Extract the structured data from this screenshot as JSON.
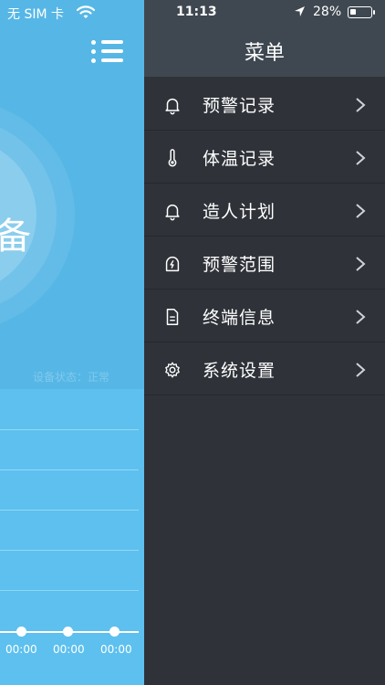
{
  "status_bar": {
    "carrier": "无 SIM 卡",
    "time": "11:13",
    "battery_pct": "28%"
  },
  "background_app": {
    "big_text": "备",
    "faint_status": "设备状态：正常",
    "times": [
      "00:00",
      "00:00",
      "00:00"
    ]
  },
  "drawer": {
    "title": "菜单",
    "items": [
      {
        "label": "预警记录",
        "icon": "bell-icon"
      },
      {
        "label": "体温记录",
        "icon": "thermometer-icon"
      },
      {
        "label": "造人计划",
        "icon": "bell-icon"
      },
      {
        "label": "预警范围",
        "icon": "alert-zone-icon"
      },
      {
        "label": "终端信息",
        "icon": "document-icon"
      },
      {
        "label": "系统设置",
        "icon": "gear-icon"
      }
    ]
  },
  "colors": {
    "primary_blue": "#56b7e6",
    "drawer_bg": "#2f3339",
    "drawer_header_bg": "#3f4851"
  }
}
